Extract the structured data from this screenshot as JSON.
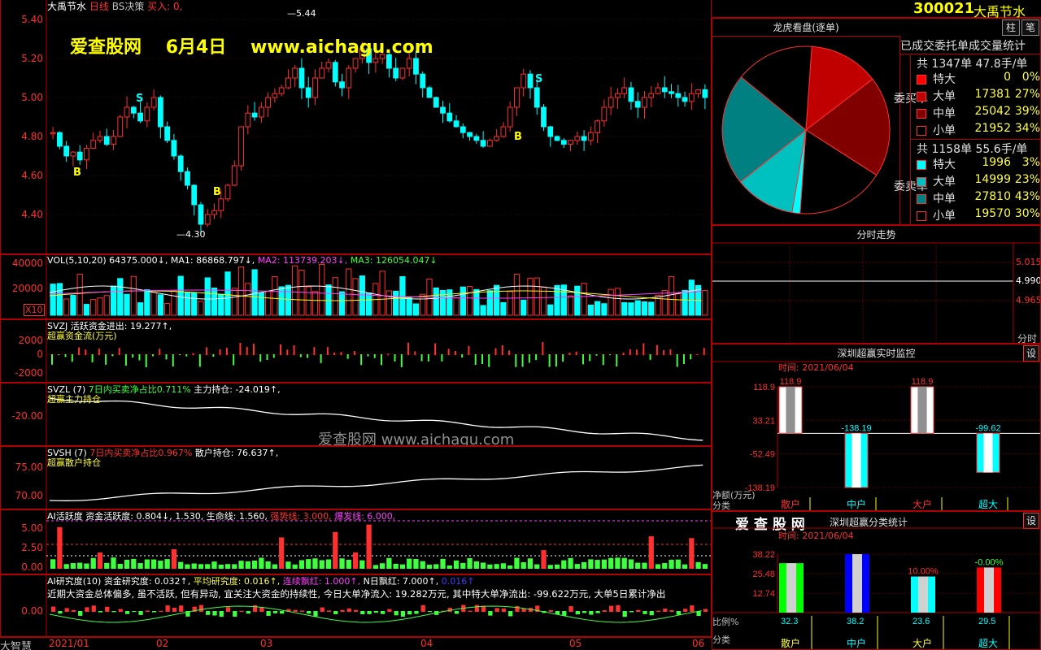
{
  "main_chart": {
    "title_left": "大禹节水",
    "title_period": "日线",
    "title_indicator": "BS决策",
    "title_buy": "买入: 0,",
    "watermark_site": "爱查股网",
    "watermark_date": "6月4日",
    "watermark_url": "www.aichagu.com",
    "price_high_label": "5.44",
    "price_low_label": "4.30",
    "y_ticks": [
      "5.40",
      "5.20",
      "5.00",
      "4.80",
      "4.60",
      "4.40"
    ],
    "markers": {
      "s": "S",
      "b": "B"
    }
  },
  "volume": {
    "label": "VOL(5,10,20) 64375.000↓, MA1: 86868.797↓, MA2: 113739.203↓, MA3: 126054.047↓",
    "label_vol": "VOL(5,10,20) 64375.000↓,",
    "label_ma1": "MA1: 86868.797↓,",
    "label_ma2": "MA2: 113739.203↓,",
    "label_ma3": "MA3: 126054.047↓",
    "y_ticks": [
      "40000",
      "20000"
    ],
    "unit": "X10"
  },
  "svzj": {
    "line1_name": "SVZJ",
    "line1_value": "活跃资金进出: 19.277↑,",
    "line2": "超赢资金流(万元)",
    "y_ticks": [
      "2000",
      "0",
      "-2000"
    ]
  },
  "svzl": {
    "name": "SVZL (7)",
    "desc": "7日内买卖净占比0.711%",
    "value": "主力持仓: -24.019↑,",
    "line2": "超赢主力持仓",
    "y_ticks": [
      "-20.00"
    ],
    "watermark": "爱查股网 www.aichagu.com"
  },
  "svsh": {
    "name": "SVSH (7)",
    "desc": "7日内买卖净占比0.967%",
    "value": "散户持仓: 76.637↑,",
    "line2": "超赢散户持仓",
    "y_ticks": [
      "75.00",
      "70.00"
    ]
  },
  "ai_active": {
    "label": "AI活跃度",
    "capital": "资金活跃度: 0.804↓,",
    "v2": "1.530,",
    "life": "生命线: 1.560,",
    "strong": "强势线: 3.000,",
    "burst": "爆发线: 6.000,",
    "y_ticks": [
      "5.00",
      "2.50",
      "0.00"
    ]
  },
  "ai_research": {
    "label": "AI研究度(10)",
    "research": "资金研究度: 0.032↑,",
    "avg": "平均研究度: 0.016↑,",
    "consec": "连续飘红: 1.000↑,",
    "n_red": "N日飘红: 7.000↑,",
    "last": "0.016↑",
    "comment": "近期大资金总体偏多, 虽不活跃, 但有异动, 宜关注大资金的持续性, 今日大单净流入: 19.282万元, 其中特大单净流出: -99.622万元, 大单5日累计净出",
    "y_ticks": [
      "0.00"
    ]
  },
  "x_axis": {
    "labels": [
      "2021/01",
      "02",
      "03",
      "04",
      "05",
      "06"
    ],
    "brand": "大智慧"
  },
  "right": {
    "code": "300021",
    "name": "大禹节水",
    "btn_bar": "柱",
    "btn_note": "笔",
    "pie_title": "龙虎看盘(逐单)",
    "stats_title": "已成交委托单成交量统计",
    "buy_group_label": "委买单",
    "sell_group_label": "委卖单",
    "buy_total": "共 1347单 47.8手/单",
    "sell_total": "共 1158单 55.6手/单",
    "buy_rows": [
      {
        "name": "特大",
        "value": "0",
        "pct": "0%",
        "color": "#ff0000"
      },
      {
        "name": "大单",
        "value": "17381",
        "pct": "27%",
        "color": "#c00000"
      },
      {
        "name": "中单",
        "value": "25042",
        "pct": "39%",
        "color": "#800000"
      },
      {
        "name": "小单",
        "value": "21952",
        "pct": "34%",
        "color": "#000000"
      }
    ],
    "sell_rows": [
      {
        "name": "特大",
        "value": "1996",
        "pct": "3%",
        "color": "#00ffff"
      },
      {
        "name": "大单",
        "value": "14999",
        "pct": "23%",
        "color": "#00c0c0"
      },
      {
        "name": "中单",
        "value": "27810",
        "pct": "43%",
        "color": "#008080"
      },
      {
        "name": "小单",
        "value": "19570",
        "pct": "30%",
        "color": "#000000"
      }
    ],
    "intraday_title": "分时走势",
    "intraday_ticks": [
      "5.015",
      "4.990",
      "4.965"
    ],
    "intraday_unit": "分时",
    "monitor_title": "深圳超赢实时监控",
    "monitor_time": "时间: 2021/06/04",
    "monitor_btn": "设",
    "monitor_y_ticks": [
      "118.9",
      "33.21",
      "-52.49",
      "-138.19"
    ],
    "monitor_values": [
      "118.9",
      "-138.19",
      "118.9",
      "-99.62"
    ],
    "monitor_unit": "净额(万元)",
    "monitor_cat_label": "分类",
    "monitor_cats": [
      "散户",
      "中户",
      "大户",
      "超大"
    ],
    "class_brand": "爱 查 股 网",
    "class_title": "深圳超赢分类统计",
    "class_time": "时间: 2021/06/04",
    "class_btn": "设",
    "class_y_ticks": [
      "38.22",
      "25.48",
      "12.74"
    ],
    "class_top_labels": [
      "10.00%",
      "-0.00%"
    ],
    "class_values": [
      "32.3",
      "38.2",
      "23.6",
      "29.5"
    ],
    "class_unit": "比例%",
    "class_cat_label": "分类",
    "class_cats": [
      "散户",
      "中户",
      "大户",
      "超大"
    ]
  },
  "chart_data": [
    {
      "type": "pie",
      "title": "龙虎看盘(逐单)",
      "categories": [
        "委买特大",
        "委买大单",
        "委买中单",
        "委买小单",
        "委卖特大",
        "委卖大单",
        "委卖中单",
        "委卖小单"
      ],
      "values": [
        0,
        17381,
        25042,
        21952,
        1996,
        14999,
        27810,
        19570
      ]
    },
    {
      "type": "bar",
      "title": "深圳超赢实时监控",
      "categories": [
        "散户",
        "中户",
        "大户",
        "超大"
      ],
      "values": [
        118.9,
        -138.19,
        118.9,
        -99.62
      ],
      "ylabel": "净额(万元)",
      "ylim": [
        -138.19,
        118.9
      ]
    },
    {
      "type": "bar",
      "title": "深圳超赢分类统计",
      "categories": [
        "散户",
        "中户",
        "大户",
        "超大"
      ],
      "values": [
        32.3,
        38.2,
        23.6,
        29.5
      ],
      "ylabel": "比例%",
      "ylim": [
        0,
        38.22
      ]
    }
  ]
}
